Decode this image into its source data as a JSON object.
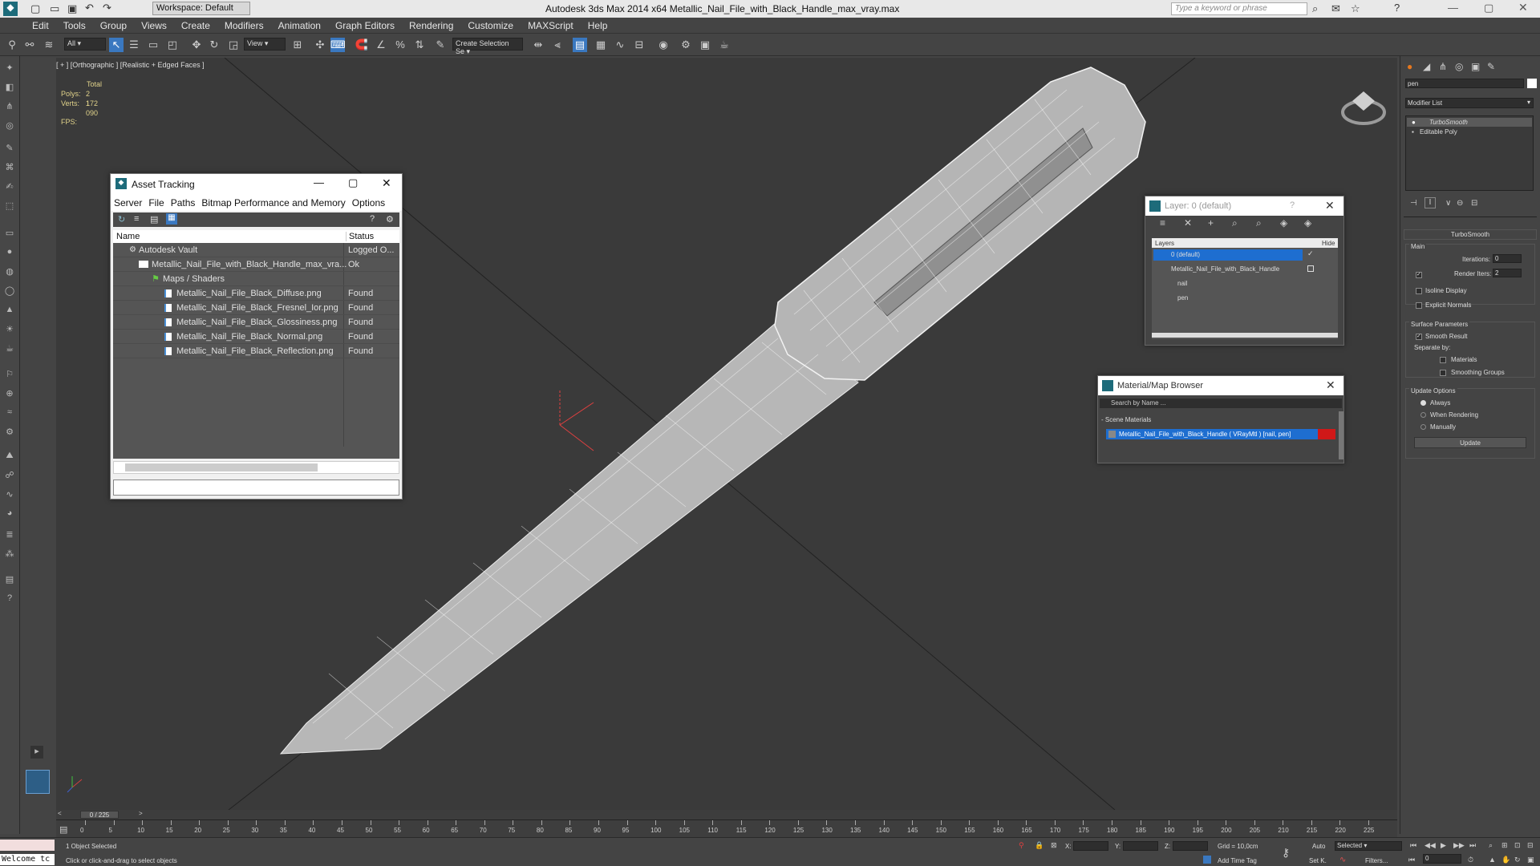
{
  "titlebar": {
    "title": "Autodesk 3ds Max  2014 x64      Metallic_Nail_File_with_Black_Handle_max_vray.max",
    "workspace": "Workspace: Default",
    "search_placeholder": "Type a keyword or phrase"
  },
  "menu": [
    "Edit",
    "Tools",
    "Group",
    "Views",
    "Create",
    "Modifiers",
    "Animation",
    "Graph Editors",
    "Rendering",
    "Customize",
    "MAXScript",
    "Help"
  ],
  "toolbar": {
    "filter": "All",
    "ref_coord": "View",
    "selection_set": "Create Selection Se"
  },
  "viewport": {
    "label": "[ + ] [Orthographic ] [Realistic + Edged Faces ]",
    "stats_total": "Total",
    "polys_label": "Polys:",
    "polys": "2 172",
    "verts_label": "Verts:",
    "verts": "1 090",
    "fps": "FPS:"
  },
  "asset_tracking": {
    "title": "Asset Tracking",
    "menu": [
      "Server",
      "File",
      "Paths",
      "Bitmap Performance and Memory",
      "Options"
    ],
    "col_name": "Name",
    "col_status": "Status",
    "rows": [
      {
        "name": "Autodesk Vault",
        "status": "Logged O..."
      },
      {
        "name": "Metallic_Nail_File_with_Black_Handle_max_vra...",
        "status": "Ok"
      },
      {
        "name": "Maps / Shaders",
        "status": ""
      },
      {
        "name": "Metallic_Nail_File_Black_Diffuse.png",
        "status": "Found"
      },
      {
        "name": "Metallic_Nail_File_Black_Fresnel_Ior.png",
        "status": "Found"
      },
      {
        "name": "Metallic_Nail_File_Black_Glossiness.png",
        "status": "Found"
      },
      {
        "name": "Metallic_Nail_File_Black_Normal.png",
        "status": "Found"
      },
      {
        "name": "Metallic_Nail_File_Black_Reflection.png",
        "status": "Found"
      }
    ]
  },
  "layer": {
    "title": "Layer: 0 (default)",
    "help": "?",
    "col_layers": "Layers",
    "col_hide": "Hide",
    "rows": [
      "0 (default)",
      "Metallic_Nail_File_with_Black_Handle",
      "nail",
      "pen"
    ]
  },
  "material_browser": {
    "title": "Material/Map Browser",
    "search_placeholder": "Search by Name ...",
    "section": "- Scene Materials",
    "item": "Metallic_Nail_File_with_Black_Handle  ( VRayMtl ) [nail, pen]"
  },
  "command_panel": {
    "object_name": "pen",
    "modifier_list": "Modifier List",
    "stack": [
      "TurboSmooth",
      "Editable Poly"
    ],
    "rollout": "TurboSmooth",
    "main": "Main",
    "iterations_label": "Iterations:",
    "iterations": "0",
    "render_iters_label": "Render Iters:",
    "render_iters": "2",
    "isoline": "Isoline Display",
    "explicit_normals": "Explicit Normals",
    "surface_params": "Surface Parameters",
    "smooth_result": "Smooth Result",
    "separate_by": "Separate by:",
    "materials": "Materials",
    "smoothing_groups": "Smoothing Groups",
    "update_options": "Update Options",
    "always": "Always",
    "when_rendering": "When Rendering",
    "manually": "Manually",
    "update_btn": "Update"
  },
  "timeline": {
    "frame": "0 / 225",
    "ticks": [
      "0",
      "5",
      "10",
      "15",
      "20",
      "25",
      "30",
      "35",
      "40",
      "45",
      "50",
      "55",
      "60",
      "65",
      "70",
      "75",
      "80",
      "85",
      "90",
      "95",
      "100",
      "105",
      "110",
      "115",
      "120",
      "125",
      "130",
      "135",
      "140",
      "145",
      "150",
      "155",
      "160",
      "165",
      "170",
      "175",
      "180",
      "185",
      "190",
      "195",
      "200",
      "205",
      "210",
      "215",
      "220",
      "225"
    ]
  },
  "status": {
    "listener": "Welcome tc",
    "selected": "1 Object Selected",
    "prompt": "Click or click-and-drag to select objects",
    "x": "X:",
    "y": "Y:",
    "z": "Z:",
    "grid": "Grid = 10,0cm",
    "add_time_tag": "Add Time Tag",
    "auto": "Auto",
    "set_k": "Set K.",
    "key_mode": "Selected",
    "filters": "Filters...",
    "frame_field": "0"
  }
}
